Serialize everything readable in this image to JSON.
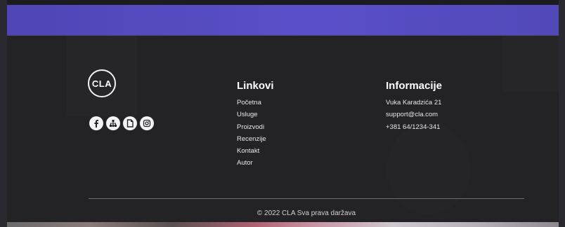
{
  "brand": {
    "logo_text": "CLA"
  },
  "socials": [
    {
      "icon": "facebook-icon"
    },
    {
      "icon": "sitemap-icon"
    },
    {
      "icon": "document-icon"
    },
    {
      "icon": "instagram-icon"
    }
  ],
  "links": {
    "title": "Linkovi",
    "items": [
      "Početna",
      "Usluge",
      "Proizvodi",
      "Recenzije",
      "Kontakt",
      "Autor"
    ]
  },
  "info": {
    "title": "Informacije",
    "items": [
      "Vuka Karadzića 21",
      "support@cla.com",
      "+381 64/1234-341"
    ]
  },
  "footer": {
    "copyright": "© 2022 CLA Sva prava daržava"
  },
  "colors": {
    "banner": "#5148b9",
    "footer_bg": "#232325",
    "text": "#ffffff"
  }
}
